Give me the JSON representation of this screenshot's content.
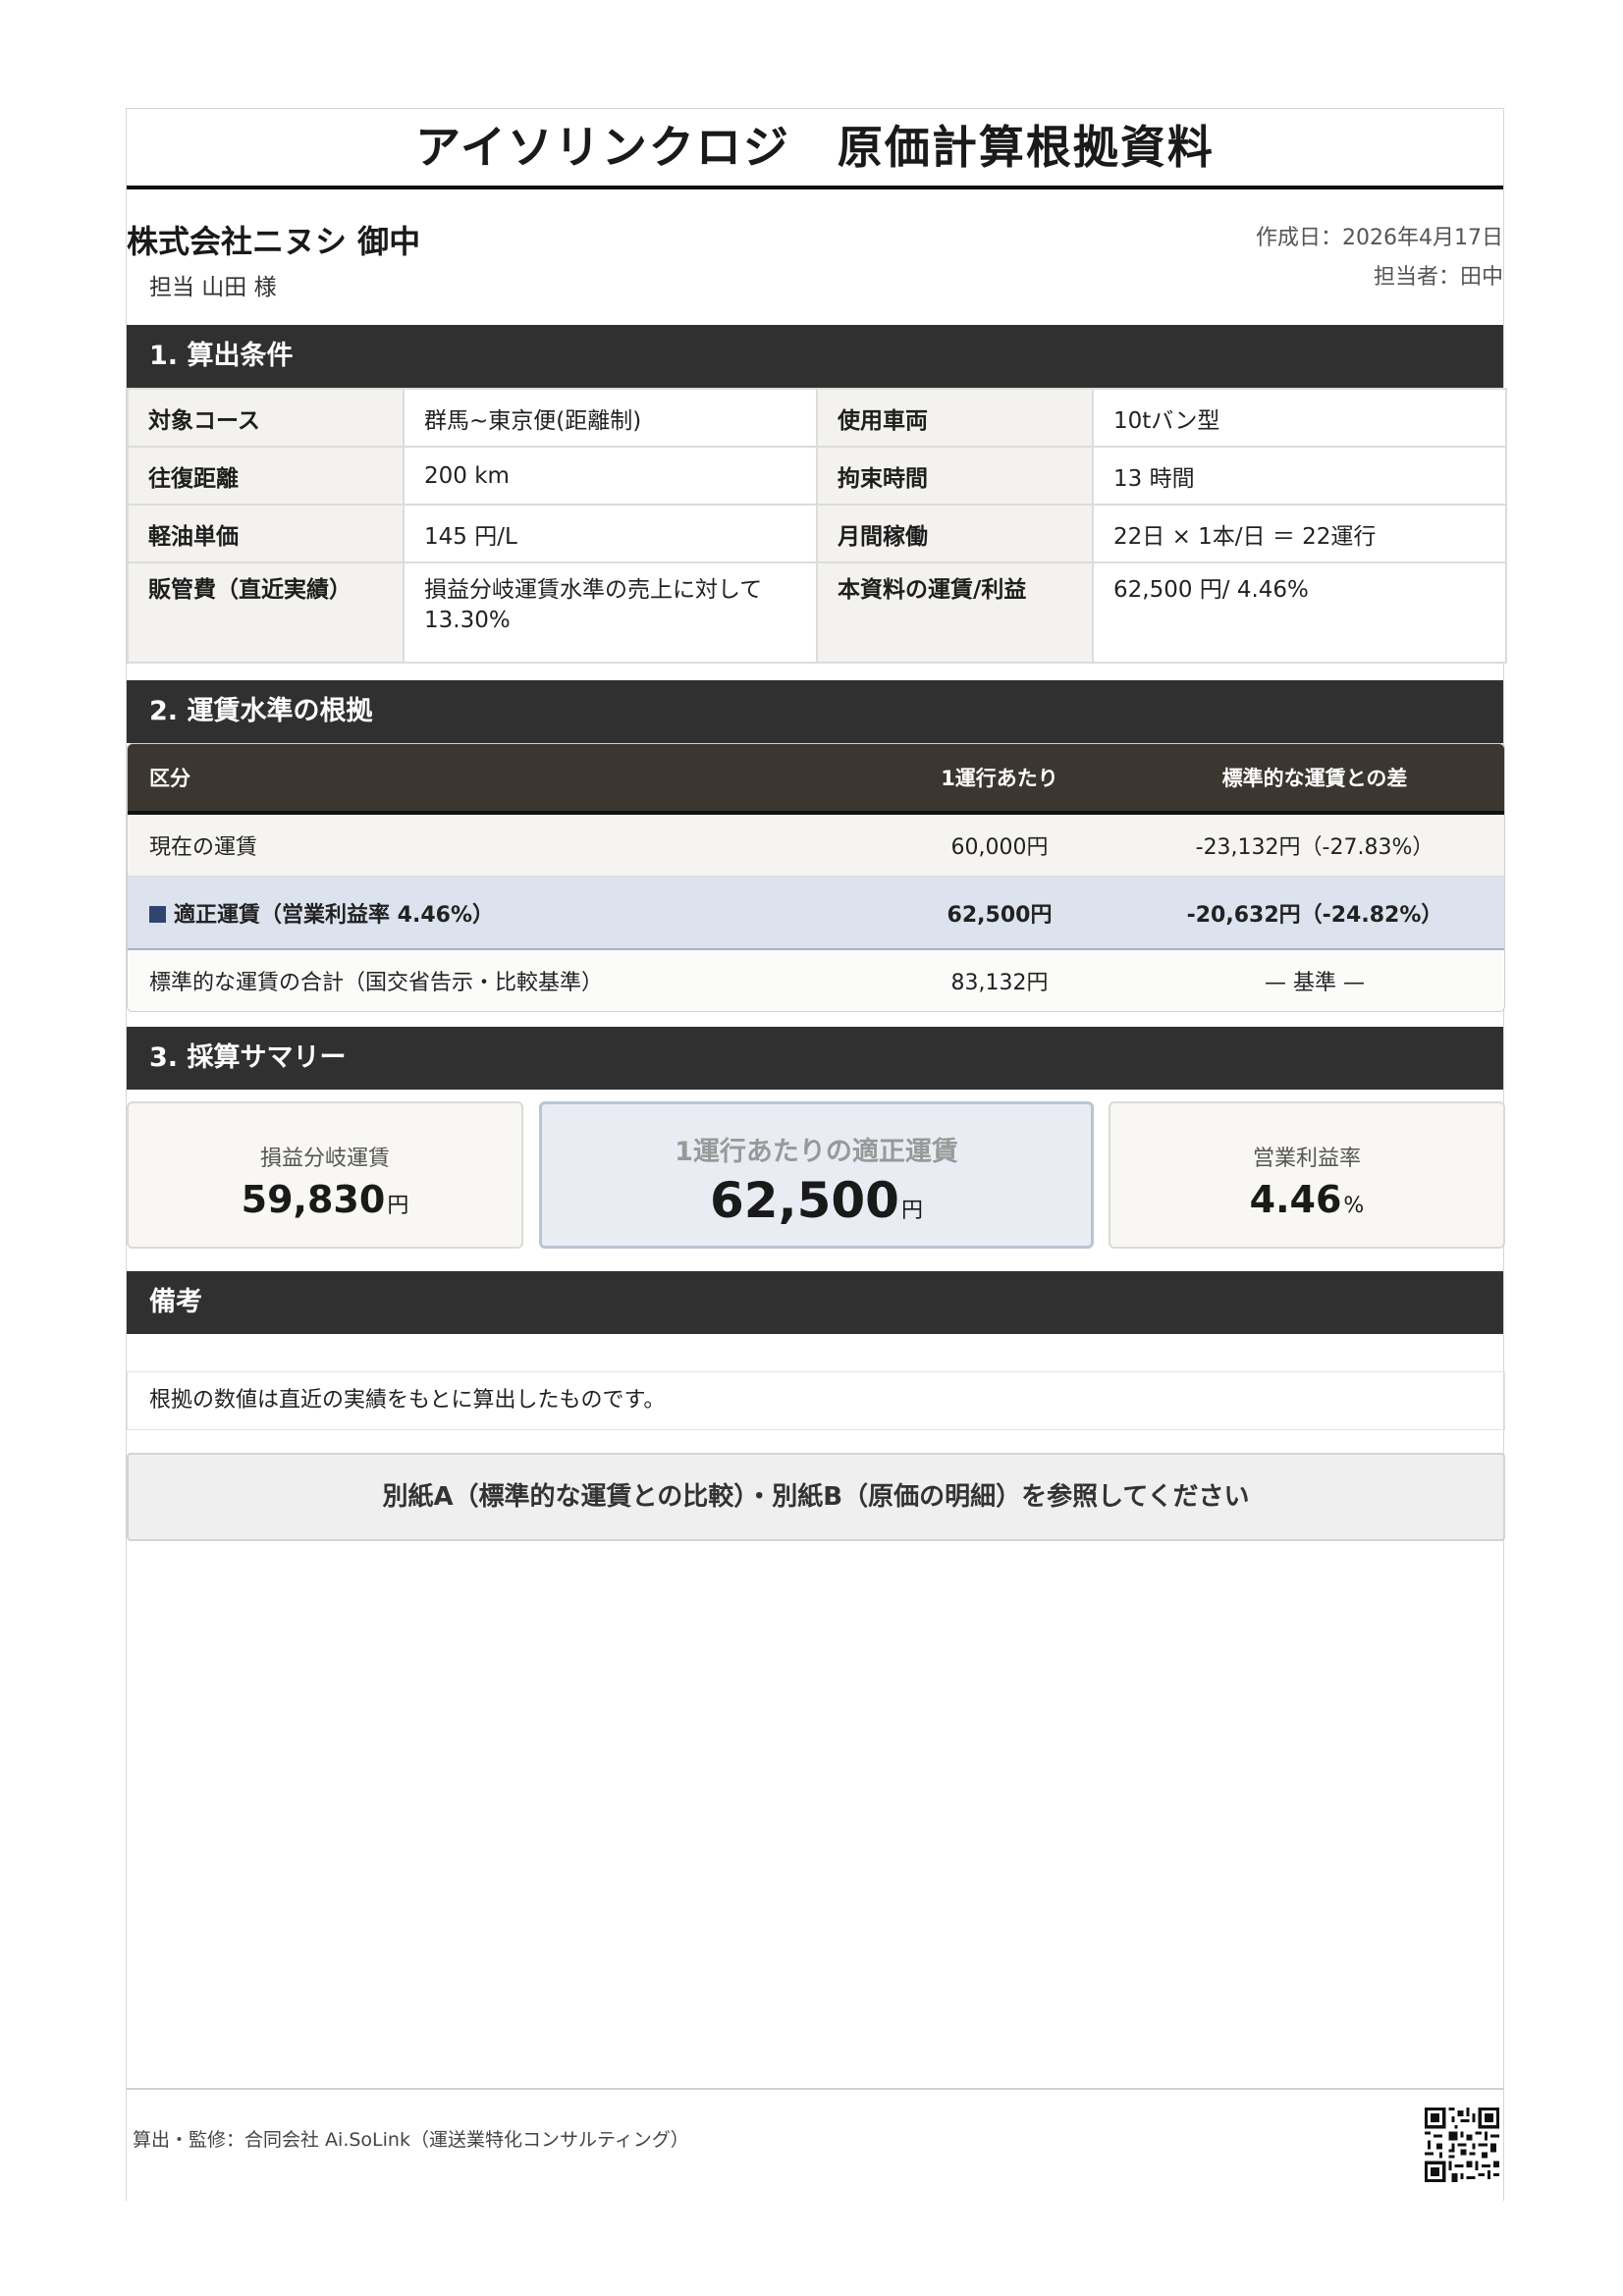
{
  "title": "アイソリンクロジ　原価計算根拠資料",
  "client": {
    "name": "株式会社ニヌシ 御中",
    "contact": "担当 山田 様"
  },
  "meta": {
    "created": "作成日：2026年4月17日",
    "author": "担当者：田中"
  },
  "section1": {
    "heading": "1. 算出条件",
    "rows": [
      {
        "l1": "対象コース",
        "v1": "群馬~東京便(距離制)",
        "l2": "使用車両",
        "v2": "10tバン型"
      },
      {
        "l1": "往復距離",
        "v1": "200 km",
        "l2": "拘束時間",
        "v2": "13 時間"
      },
      {
        "l1": "軽油単価",
        "v1": "145 円/L",
        "l2": "月間稼働",
        "v2": "22日 × 1本/日 ＝ 22運行"
      },
      {
        "l1": "販管費（直近実績）",
        "v1": "損益分岐運賃水準の売上に対して13.30%",
        "l2": "本資料の運賃/利益",
        "v2": "62,500 円/ 4.46%"
      }
    ]
  },
  "section2": {
    "heading": "2. 運賃水準の根拠",
    "headers": [
      "区分",
      "1運行あたり",
      "標準的な運賃との差"
    ],
    "rows": [
      {
        "label": "現在の運賃",
        "per_trip": "60,000円",
        "diff": "-23,132円（-27.83%）"
      },
      {
        "label": "適正運賃（営業利益率 4.46%）",
        "per_trip": "62,500円",
        "diff": "-20,632円（-24.82%）"
      },
      {
        "label": "標準的な運賃の合計（国交省告示・比較基準）",
        "per_trip": "83,132円",
        "diff": "— 基準 —"
      }
    ]
  },
  "section3": {
    "heading": "3. 採算サマリー",
    "cards": [
      {
        "label": "損益分岐運賃",
        "value": "59,830",
        "unit": "円"
      },
      {
        "label": "1運行あたりの適正運賃",
        "value": "62,500",
        "unit": "円"
      },
      {
        "label": "営業利益率",
        "value": "4.46",
        "unit": "%"
      }
    ]
  },
  "remarks": {
    "heading": "備考",
    "text": "根拠の数値は直近の実績をもとに算出したものです。"
  },
  "reference": "別紙A（標準的な運賃との比較）・別紙B（原価の明細）を参照してください",
  "footer": "算出・監修：合同会社 Ai.SoLink（運送業特化コンサルティング）",
  "colors": {
    "section_bg": "#303030",
    "table_header_bg": "#3c3631",
    "highlight_row": "#dde3ee",
    "accent_square": "#2f4570"
  }
}
